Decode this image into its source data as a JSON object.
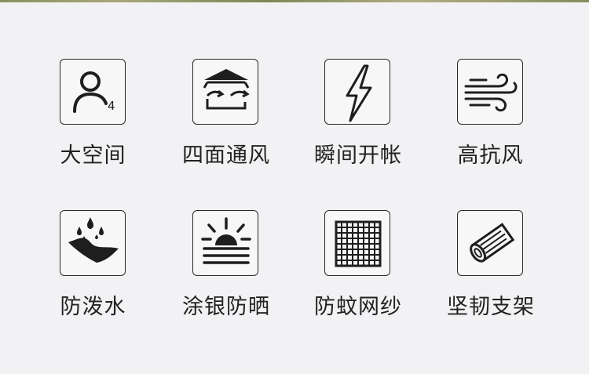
{
  "colors": {
    "background": "#f2f1f3",
    "icon_stroke": "#1e1e1e",
    "label_text": "#222222"
  },
  "features": [
    {
      "label": "大空间",
      "icon": "person-capacity-4-icon",
      "badge": "4"
    },
    {
      "label": "四面通风",
      "icon": "tent-ventilation-arrows-icon"
    },
    {
      "label": "瞬间开帐",
      "icon": "lightning-bolt-icon"
    },
    {
      "label": "高抗风",
      "icon": "wind-icon"
    },
    {
      "label": "防泼水",
      "icon": "water-drops-fabric-icon"
    },
    {
      "label": "涂银防晒",
      "icon": "sun-shield-icon"
    },
    {
      "label": "防蚊网纱",
      "icon": "mesh-grid-icon"
    },
    {
      "label": "坚韧支架",
      "icon": "tube-pole-icon"
    }
  ]
}
